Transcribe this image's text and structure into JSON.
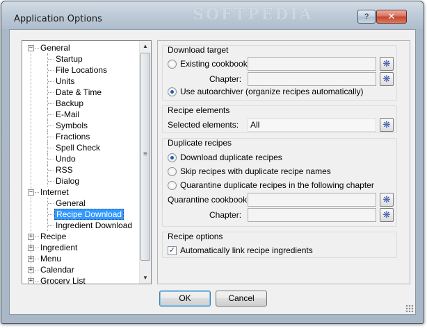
{
  "window": {
    "title": "Application Options",
    "watermark": "SOFTPEDIA",
    "help_label": "?",
    "close_label": "✕"
  },
  "tree": {
    "nodes": [
      {
        "label": "General",
        "level": 0,
        "expander": "−"
      },
      {
        "label": "Startup",
        "level": 1
      },
      {
        "label": "File Locations",
        "level": 1
      },
      {
        "label": "Units",
        "level": 1
      },
      {
        "label": "Date & Time",
        "level": 1
      },
      {
        "label": "Backup",
        "level": 1
      },
      {
        "label": "E-Mail",
        "level": 1
      },
      {
        "label": "Symbols",
        "level": 1
      },
      {
        "label": "Fractions",
        "level": 1
      },
      {
        "label": "Spell Check",
        "level": 1
      },
      {
        "label": "Undo",
        "level": 1
      },
      {
        "label": "RSS",
        "level": 1
      },
      {
        "label": "Dialog",
        "level": 1
      },
      {
        "label": "Internet",
        "level": 0,
        "expander": "−"
      },
      {
        "label": "General",
        "level": 1
      },
      {
        "label": "Recipe Download",
        "level": 1,
        "selected": true
      },
      {
        "label": "Ingredient Download",
        "level": 1
      },
      {
        "label": "Recipe",
        "level": 0,
        "expander": "+"
      },
      {
        "label": "Ingredient",
        "level": 0,
        "expander": "+"
      },
      {
        "label": "Menu",
        "level": 0,
        "expander": "+"
      },
      {
        "label": "Calendar",
        "level": 0,
        "expander": "+"
      },
      {
        "label": "Grocery List",
        "level": 0,
        "expander": "+"
      }
    ],
    "scroll_up": "▲",
    "scroll_down": "▼",
    "grip": "≡"
  },
  "download_target": {
    "title": "Download target",
    "existing_label": "Existing cookbook:",
    "existing_value": "",
    "chapter_label": "Chapter:",
    "chapter_value": "",
    "autoarchiver_label": "Use autoarchiver (organize recipes automatically)",
    "selected": "autoarchiver",
    "browse": "❋"
  },
  "recipe_elements": {
    "title": "Recipe elements",
    "selected_label": "Selected elements:",
    "selected_value": "All"
  },
  "duplicate": {
    "title": "Duplicate recipes",
    "options": [
      "Download duplicate recipes",
      "Skip recipes with duplicate recipe names",
      "Quarantine duplicate recipes in the following chapter"
    ],
    "selected_index": 0,
    "quarantine_label": "Quarantine cookbook:",
    "quarantine_value": "",
    "chapter_label": "Chapter:",
    "chapter_value": ""
  },
  "recipe_options": {
    "title": "Recipe options",
    "auto_link_label": "Automatically link recipe ingredients",
    "auto_link_checked": true,
    "check_mark": "✓"
  },
  "buttons": {
    "ok": "OK",
    "cancel": "Cancel"
  }
}
